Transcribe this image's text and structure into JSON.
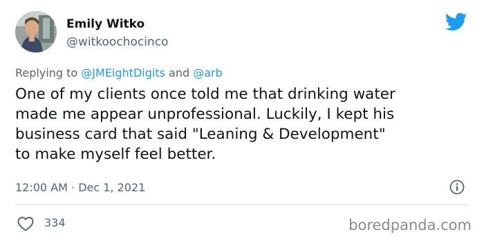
{
  "author": {
    "name": "Emily Witko",
    "handle": "@witkoochocinco"
  },
  "reply": {
    "prefix": "Replying to ",
    "user1": "@JMEightDigits",
    "conj": " and ",
    "user2": "@arb"
  },
  "tweet": {
    "text": "One of my clients once told me that drinking water\nmade me appear unprofessional. Luckily, I kept his\nbusiness card that said \"Leaning & Development\"\nto make myself feel better."
  },
  "meta": {
    "timestamp": "12:00 AM · Dec 1, 2021"
  },
  "engagement": {
    "likes": "334"
  },
  "watermark": "boredpanda.com",
  "icons": {
    "brand": "twitter-bird-icon",
    "info": "info-icon",
    "like": "heart-icon"
  },
  "colors": {
    "twitter_blue": "#1d9bf0",
    "text_primary": "#0f1419",
    "text_secondary": "#536471",
    "link": "#1d9bf0",
    "divider": "#cfd9de"
  }
}
